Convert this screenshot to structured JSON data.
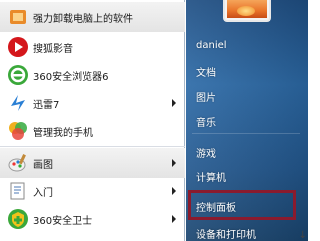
{
  "programs": [
    {
      "label": "强力卸载电脑上的软件",
      "icon": "uninstall-icon",
      "has_arrow": false
    },
    {
      "label": "搜狐影音",
      "icon": "sohu-video-icon",
      "has_arrow": false
    },
    {
      "label": "360安全浏览器6",
      "icon": "360-browser-icon",
      "has_arrow": false
    },
    {
      "label": "迅雷7",
      "icon": "xunlei-icon",
      "has_arrow": true
    },
    {
      "label": "管理我的手机",
      "icon": "phone-manager-icon",
      "has_arrow": false
    },
    {
      "label": "画图",
      "icon": "paint-icon",
      "has_arrow": true
    },
    {
      "label": "入门",
      "icon": "getting-started-icon",
      "has_arrow": true
    },
    {
      "label": "360安全卫士",
      "icon": "360-safe-icon",
      "has_arrow": true
    }
  ],
  "right_menu": {
    "user": "daniel",
    "items": [
      "文档",
      "图片",
      "音乐",
      "游戏",
      "计算机",
      "控制面板",
      "设备和打印机"
    ],
    "highlighted": "控制面板"
  },
  "colors": {
    "right_pane_bg": "#2c6aa7",
    "highlight_border": "#8a1b2e"
  }
}
